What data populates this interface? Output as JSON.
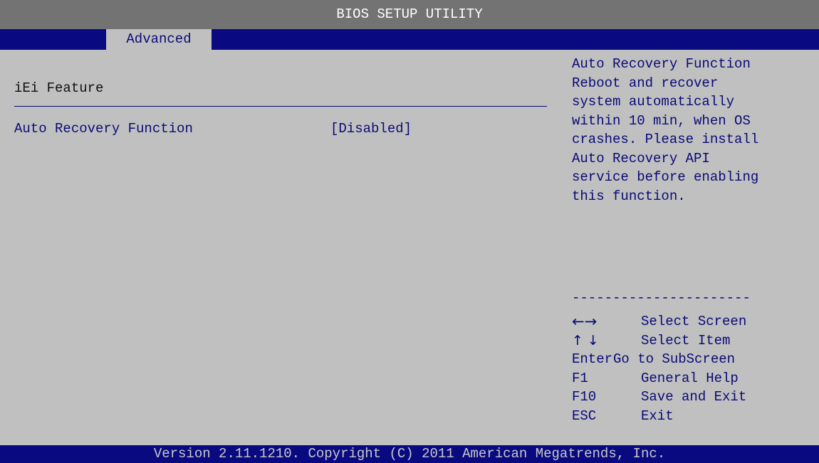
{
  "title": "BIOS SETUP UTILITY",
  "tabs": [
    {
      "label": "Advanced",
      "active": true
    }
  ],
  "main": {
    "section_title": "iEi Feature",
    "settings": [
      {
        "label": "Auto Recovery Function",
        "value": "[Disabled]"
      }
    ]
  },
  "help": {
    "lines": [
      "Auto Recovery Function",
      "Reboot and recover",
      "system automatically",
      "within 10 min, when OS",
      "crashes. Please install",
      "Auto Recovery API",
      "service before enabling",
      "this function."
    ],
    "separator": "----------------------",
    "keys": [
      {
        "key": "←→",
        "desc": "Select Screen",
        "icon": "left-right-arrows-icon"
      },
      {
        "key": "↑↓",
        "desc": "Select Item",
        "icon": "up-down-arrows-icon"
      },
      {
        "key": "Enter",
        "desc": "Go to SubScreen"
      },
      {
        "key": "F1",
        "desc": "General Help"
      },
      {
        "key": "F10",
        "desc": "Save and Exit"
      },
      {
        "key": "ESC",
        "desc": "Exit"
      }
    ]
  },
  "footer": {
    "text": "Version 2.11.1210. Copyright (C) 2011 American Megatrends, Inc."
  },
  "colors": {
    "background": "#c0c0c0",
    "title_bar": "#737373",
    "accent_blue": "#0a0a80",
    "text_blue": "#0a0a78"
  }
}
